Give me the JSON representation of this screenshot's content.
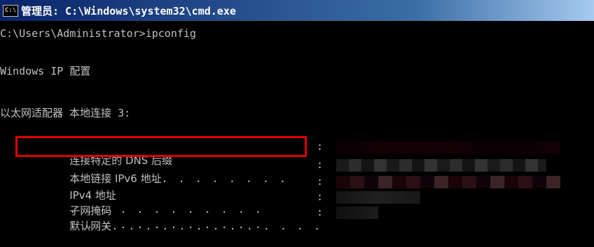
{
  "window": {
    "title": "管理员: C:\\Windows\\system32\\cmd.exe",
    "icon": "cmd-icon",
    "icon_text": "C:\\"
  },
  "console": {
    "prompt_line": "C:\\Users\\Administrator>ipconfig",
    "header": "Windows IP 配置",
    "adapter": "以太网适配器 本地连接 3:",
    "fields": [
      {
        "label": "连接特定的 DNS 后缀",
        "dots": ". . . . . . .",
        "colon": ":"
      },
      {
        "label": "本地链接 IPv6 地址",
        "dots": ". . . . . . . .",
        "colon": ":"
      },
      {
        "label": "IPv4 地址",
        "dots": ". . . . . . . . . . . .",
        "colon": ":"
      },
      {
        "label": "子网掩码",
        "dots": ". . . . . . . . . . . .",
        "colon": ":"
      },
      {
        "label": "默认网关",
        "dots": ". . . . . . . . . . . . .",
        "colon": ":"
      }
    ]
  },
  "colors": {
    "console_bg": "#000000",
    "console_fg": "#c0c0c0",
    "highlight": "#e00000"
  }
}
